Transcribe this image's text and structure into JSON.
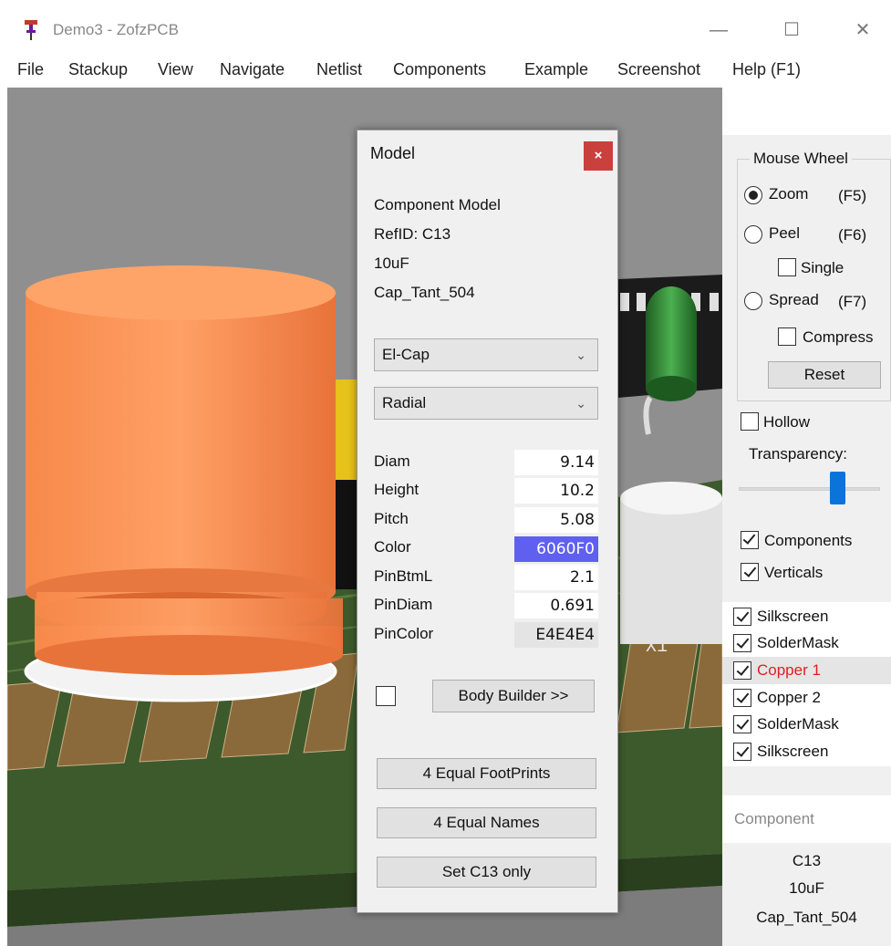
{
  "window": {
    "title": "Demo3 - ZofzPCB",
    "controls": {
      "minimize": "—",
      "maximize": "☐",
      "close": "✕"
    }
  },
  "menu": [
    {
      "label": "File",
      "accel": "F"
    },
    {
      "label": "Stackup",
      "accel": "S"
    },
    {
      "label": "View",
      "accel": "V"
    },
    {
      "label": "Navigate",
      "accel": "N"
    },
    {
      "label": "Netlist",
      "accel": "N"
    },
    {
      "label": "Components",
      "accel": "C"
    },
    {
      "label": "Example",
      "accel": "E"
    },
    {
      "label": "Screenshot",
      "accel": "r"
    },
    {
      "label": "Help (F1)",
      "accel": "H"
    }
  ],
  "dialog": {
    "title": "Model",
    "close": "×",
    "info": [
      "Component Model",
      "RefID: C13",
      "10uF",
      "Cap_Tant_504"
    ],
    "combo_type": "El-Cap",
    "combo_style": "Radial",
    "params": [
      {
        "label": "Diam",
        "value": "9.14"
      },
      {
        "label": "Height",
        "value": "10.2"
      },
      {
        "label": "Pitch",
        "value": "5.08"
      },
      {
        "label": "Color",
        "value": "6060F0"
      },
      {
        "label": "PinBtmL",
        "value": "2.1"
      },
      {
        "label": "PinDiam",
        "value": "0.691"
      },
      {
        "label": "PinColor",
        "value": "E4E4E4"
      }
    ],
    "color_swatch": "#6060F0",
    "body_builder": "Body Builder >>",
    "btn_footprints": "4 Equal FootPrints",
    "btn_names": "4 Equal Names",
    "btn_set": "Set C13 only"
  },
  "panel": {
    "mouse_wheel": "Mouse Wheel",
    "zoom": "Zoom",
    "zoom_key": "(F5)",
    "peel": "Peel",
    "peel_key": "(F6)",
    "single": "Single",
    "spread": "Spread",
    "spread_key": "(F7)",
    "compress": "Compress",
    "reset": "Reset",
    "hollow": "Hollow",
    "transparency": "Transparency:",
    "transparency_level": 0.7,
    "components": "Components",
    "verticals": "Verticals",
    "layers": [
      {
        "label": "Silkscreen",
        "checked": true
      },
      {
        "label": "SolderMask",
        "checked": true
      },
      {
        "label": "Copper  1",
        "checked": true,
        "color": "#e02020"
      },
      {
        "label": "Copper  2",
        "checked": true
      },
      {
        "label": "SolderMask",
        "checked": true
      },
      {
        "label": "Silkscreen",
        "checked": true
      }
    ],
    "component_header": "Component",
    "component_info": [
      "C13",
      "10uF",
      "Cap_Tant_504"
    ]
  },
  "scene": {
    "silk_label_1": "X1",
    "colors": {
      "capacitor": "#f58b4c",
      "board": "#3b5a2a",
      "pads": "#8a6a3a",
      "resistor": "#2e7d32"
    }
  }
}
